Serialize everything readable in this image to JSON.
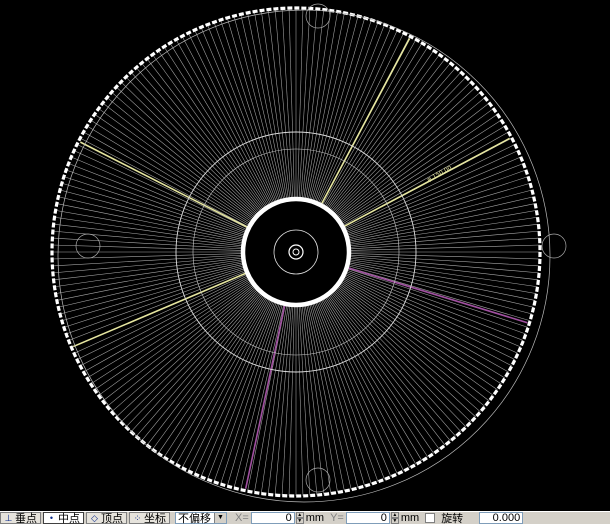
{
  "colors": {
    "background": "#000000",
    "spoke": "#c8c8c8",
    "rim": "#ffffff",
    "highlight_yellow": "#e6e6a0",
    "highlight_purple": "#a050a0",
    "statusbar": "#d4d0c8"
  },
  "drawing": {
    "spoke_count": 220,
    "yellow_spoke_angles_deg": [
      -62,
      -28,
      157,
      207
    ],
    "purple_spoke_angles_deg": [
      17,
      102
    ],
    "dimension_text": "φ 150.00"
  },
  "statusbar": {
    "snap_perp": {
      "label": "垂点",
      "icon": "perpendicular-icon",
      "active": false
    },
    "snap_mid": {
      "label": "中点",
      "icon": "midpoint-icon",
      "active": true
    },
    "snap_vertex": {
      "label": "顶点",
      "icon": "vertex-icon",
      "active": false
    },
    "snap_coord": {
      "label": "坐标",
      "icon": "coordinate-icon",
      "active": false
    },
    "offset_select": {
      "value": "不偏移"
    },
    "x_label": "X=",
    "x_value": "0",
    "y_label": "Y=",
    "y_value": "0",
    "unit": "mm",
    "rotate_label": "旋转",
    "rotate_value": "0.000"
  }
}
